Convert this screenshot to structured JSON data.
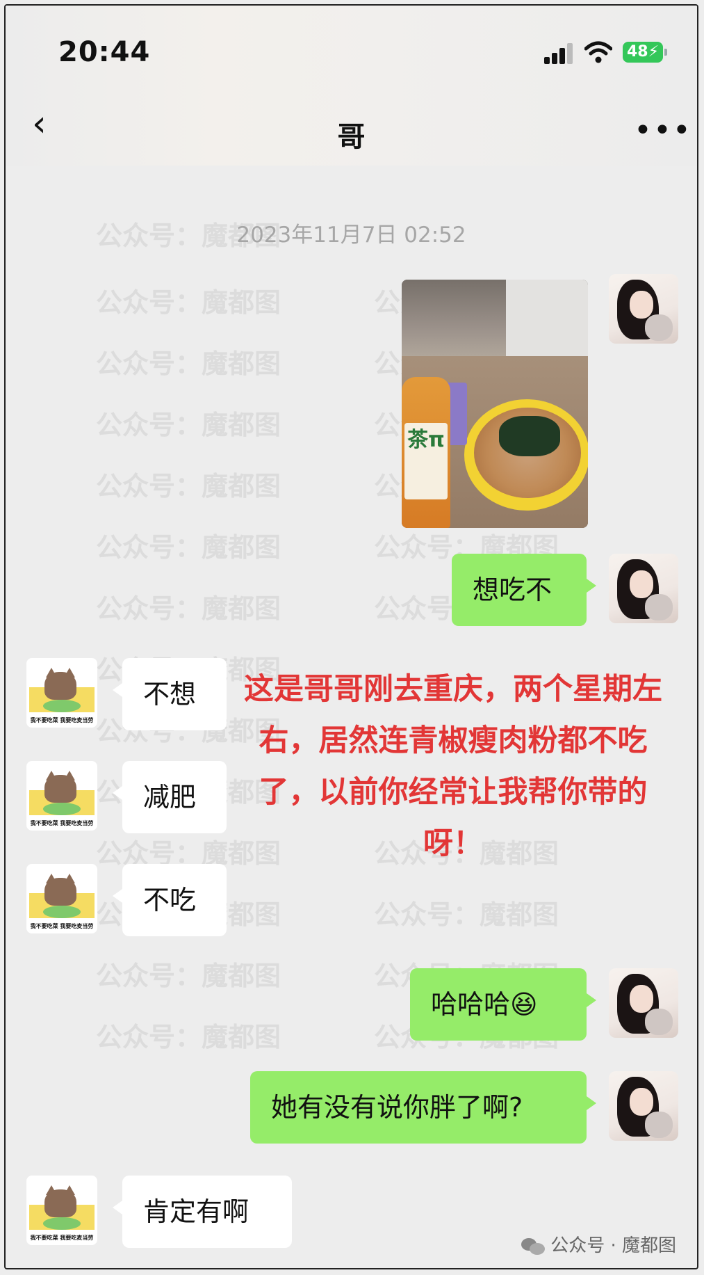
{
  "status_bar": {
    "time": "20:44",
    "battery": "48"
  },
  "header": {
    "title": "哥",
    "back_icon": "chevron-left-icon",
    "more_icon": "more-dots-icon"
  },
  "chat": {
    "timestamp": "2023年11月7日 02:52",
    "messages": [
      {
        "from": "me",
        "type": "image",
        "text": ""
      },
      {
        "from": "me",
        "type": "text",
        "text": "想吃不"
      },
      {
        "from": "them",
        "type": "text",
        "text": "不想"
      },
      {
        "from": "them",
        "type": "text",
        "text": "减肥"
      },
      {
        "from": "them",
        "type": "text",
        "text": "不吃"
      },
      {
        "from": "me",
        "type": "text",
        "text": "哈哈哈😆"
      },
      {
        "from": "me",
        "type": "text",
        "text": "她有没有说你胖了啊?"
      },
      {
        "from": "them",
        "type": "text",
        "text": "肯定有啊"
      }
    ]
  },
  "photo": {
    "bottle_label": "茶π"
  },
  "contact_avatar_caption": "我不要吃菜 我要吃麦当劳",
  "annotation": "这是哥哥刚去重庆，两个星期左右，居然连青椒瘦肉粉都不吃了，以前你经常让我帮你带的呀！",
  "watermark_text": "公众号：魔都图",
  "footer": "公众号 · 魔都图",
  "colors": {
    "my_bubble": "#95ec69",
    "their_bubble": "#ffffff",
    "annotation": "#e23636",
    "background": "#ededed"
  }
}
